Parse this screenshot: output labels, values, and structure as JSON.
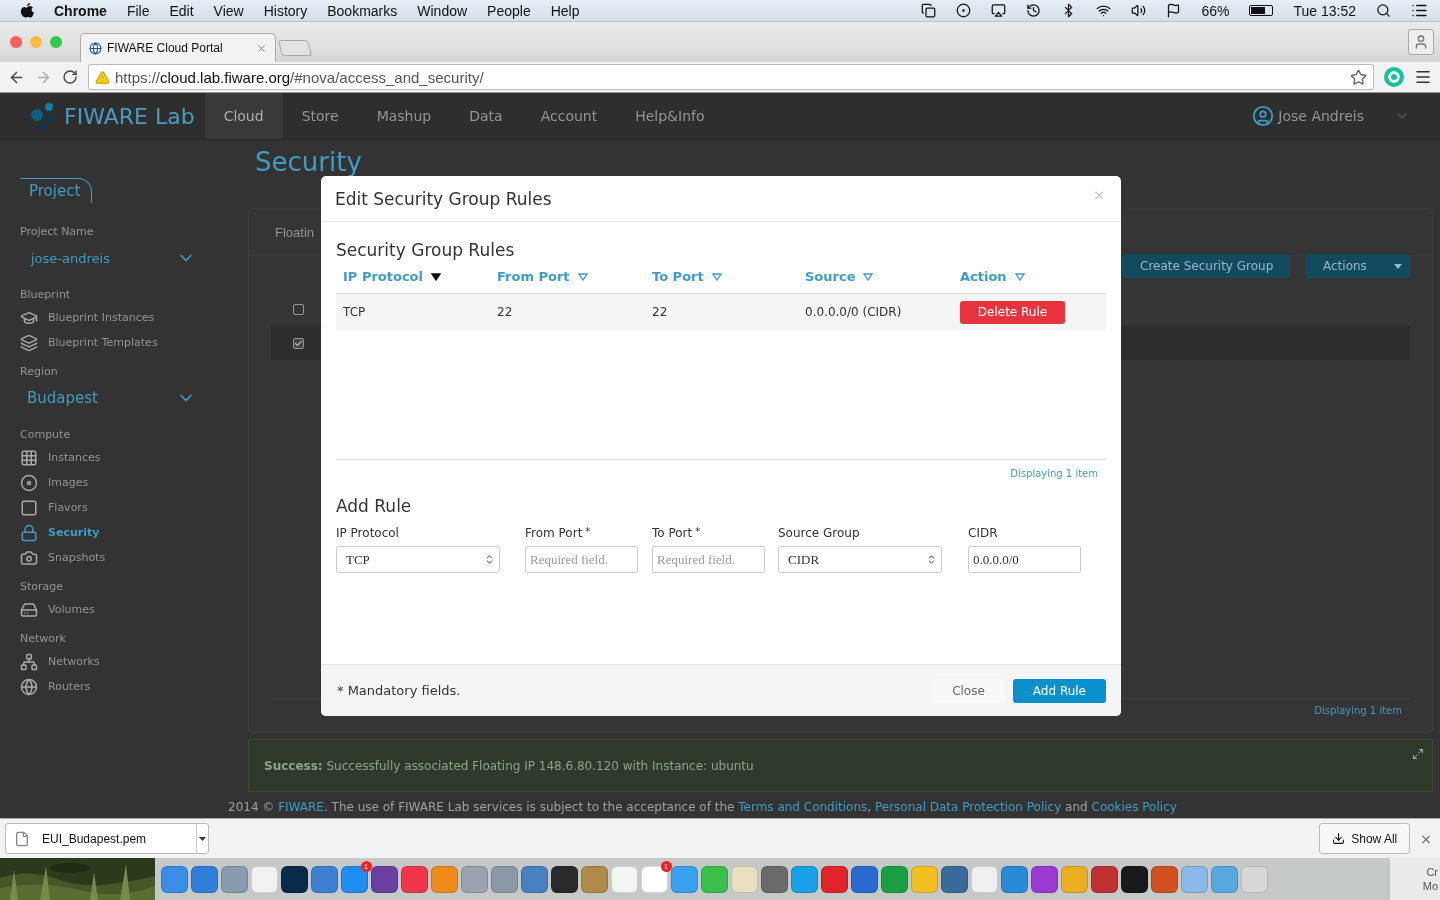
{
  "menubar": {
    "app": "Chrome",
    "items": [
      "File",
      "Edit",
      "View",
      "History",
      "Bookmarks",
      "Window",
      "People",
      "Help"
    ],
    "battery": "66%",
    "clock": "Tue 13:52"
  },
  "browser": {
    "tab_title": "FIWARE Cloud Portal",
    "url_scheme": "https://",
    "url_host": "cloud.lab.fiware.org",
    "url_path": "/#nova/access_and_security/"
  },
  "header": {
    "logo": "FIWARE Lab",
    "nav": [
      {
        "label": "Cloud",
        "selected": true
      },
      {
        "label": "Store",
        "selected": false
      },
      {
        "label": "Mashup",
        "selected": false
      },
      {
        "label": "Data",
        "selected": false
      },
      {
        "label": "Account",
        "selected": false
      },
      {
        "label": "Help&Info",
        "selected": false
      }
    ],
    "user": "Jose Andreis"
  },
  "sidebar": {
    "tab": "Project",
    "blocks": [
      {
        "kind": "select",
        "label": "Project Name",
        "value": "jose-andreis"
      },
      {
        "kind": "menu",
        "title": "Blueprint",
        "items": [
          {
            "label": "Blueprint Instances",
            "selected": false
          },
          {
            "label": "Blueprint Templates",
            "selected": false
          }
        ]
      },
      {
        "kind": "select",
        "label": "Region",
        "value": "Budapest"
      },
      {
        "kind": "menu",
        "title": "Compute",
        "items": [
          {
            "label": "Instances",
            "selected": false
          },
          {
            "label": "Images",
            "selected": false
          },
          {
            "label": "Flavors",
            "selected": false
          },
          {
            "label": "Security",
            "selected": true
          },
          {
            "label": "Snapshots",
            "selected": false
          }
        ]
      },
      {
        "kind": "menu",
        "title": "Storage",
        "items": [
          {
            "label": "Volumes",
            "selected": false
          }
        ]
      },
      {
        "kind": "menu",
        "title": "Network",
        "items": [
          {
            "label": "Networks",
            "selected": false
          },
          {
            "label": "Routers",
            "selected": false
          }
        ]
      }
    ]
  },
  "main": {
    "title": "Security",
    "tab": "Floatin",
    "buttons": [
      "Create Security Group",
      "Actions"
    ],
    "rows": [
      {
        "checked": false
      },
      {
        "checked": true
      }
    ],
    "displaying": "Displaying 1 item",
    "alert": {
      "label": "Success:",
      "text": "Successfully associated Floating IP 148.6.80.120 with Instance: ubuntu"
    },
    "footer": [
      {
        "text": "2014 © ",
        "link": false
      },
      {
        "text": "FIWARE",
        "link": true
      },
      {
        "text": ". The use of FIWARE Lab services is subject to the acceptance of the ",
        "link": false
      },
      {
        "text": "Terms and Conditions",
        "link": true
      },
      {
        "text": ", ",
        "link": false
      },
      {
        "text": "Personal Data Protection Policy",
        "link": true
      },
      {
        "text": " and ",
        "link": false
      },
      {
        "text": "Cookies Policy",
        "link": true
      }
    ]
  },
  "modal": {
    "title": "Edit Security Group Rules",
    "close": "×",
    "section_title": "Security Group Rules",
    "columns": [
      {
        "label": "IP Protocol",
        "sorted": true
      },
      {
        "label": "From Port",
        "sorted": false
      },
      {
        "label": "To Port",
        "sorted": false
      },
      {
        "label": "Source",
        "sorted": false
      },
      {
        "label": "Action",
        "sorted": false
      }
    ],
    "rows": [
      {
        "cells": [
          "TCP",
          "22",
          "22",
          "0.0.0.0/0 (CIDR)"
        ],
        "action": "Delete Rule"
      }
    ],
    "displaying": "Displaying 1 item",
    "add_title": "Add Rule",
    "fields": [
      {
        "kind": "select",
        "label": "IP Protocol",
        "value": "TCP"
      },
      {
        "kind": "input",
        "label": "From Port",
        "mark": "*",
        "placeholder": "Required field."
      },
      {
        "kind": "input",
        "label": "To Port",
        "mark": "*",
        "placeholder": "Required field."
      },
      {
        "kind": "select",
        "label": "Source Group",
        "value": "CIDR"
      },
      {
        "kind": "input",
        "label": "CIDR",
        "value": "0.0.0.0/0"
      }
    ],
    "note": "* Mandatory fields.",
    "buttons": [
      {
        "label": "Close",
        "kind": "secondary"
      },
      {
        "label": "Add Rule",
        "kind": "primary"
      }
    ]
  },
  "downloads": {
    "file": "EUI_Budapest.pem",
    "show_all": "Show All",
    "close": "×"
  },
  "dock": {
    "apps": [
      {
        "color": "#3a8ee6"
      },
      {
        "color": "#2f7fd8"
      },
      {
        "color": "#8a9bb0"
      },
      {
        "color": "#f2f2f2"
      },
      {
        "color": "#0a2a4a"
      },
      {
        "color": "#3d7fd0"
      },
      {
        "color": "#1f8ef0",
        "badge": "1"
      },
      {
        "color": "#6b3fa0"
      },
      {
        "color": "#f0364a"
      },
      {
        "color": "#f08a1a"
      },
      {
        "color": "#9aa3ad"
      },
      {
        "color": "#8c98a6"
      },
      {
        "color": "#4a7fc0"
      },
      {
        "color": "#2a2a2a"
      },
      {
        "color": "#b08a4a"
      },
      {
        "color": "#f4f4f4"
      },
      {
        "color": "#ffffff",
        "badge": "1"
      },
      {
        "color": "#3aa0f0"
      },
      {
        "color": "#3ac04a"
      },
      {
        "color": "#e8e0c0"
      },
      {
        "color": "#6a6a6a"
      },
      {
        "color": "#1aa0e8"
      },
      {
        "color": "#e0242a"
      },
      {
        "color": "#2a6ad0"
      },
      {
        "color": "#1aa040"
      },
      {
        "color": "#f0c020"
      },
      {
        "color": "#3a6a9a"
      },
      {
        "color": "#f0f0f0"
      },
      {
        "color": "#2a8ad8"
      },
      {
        "color": "#9a3ad0"
      },
      {
        "color": "#e8b020"
      },
      {
        "color": "#c03030"
      },
      {
        "color": "#1a1a1a"
      },
      {
        "color": "#d05020"
      },
      {
        "color": "#8ab8e8"
      },
      {
        "color": "#5aa8e0"
      },
      {
        "color": "#d8d8d8"
      }
    ]
  },
  "desktop": [
    "Cr",
    "Mo"
  ]
}
